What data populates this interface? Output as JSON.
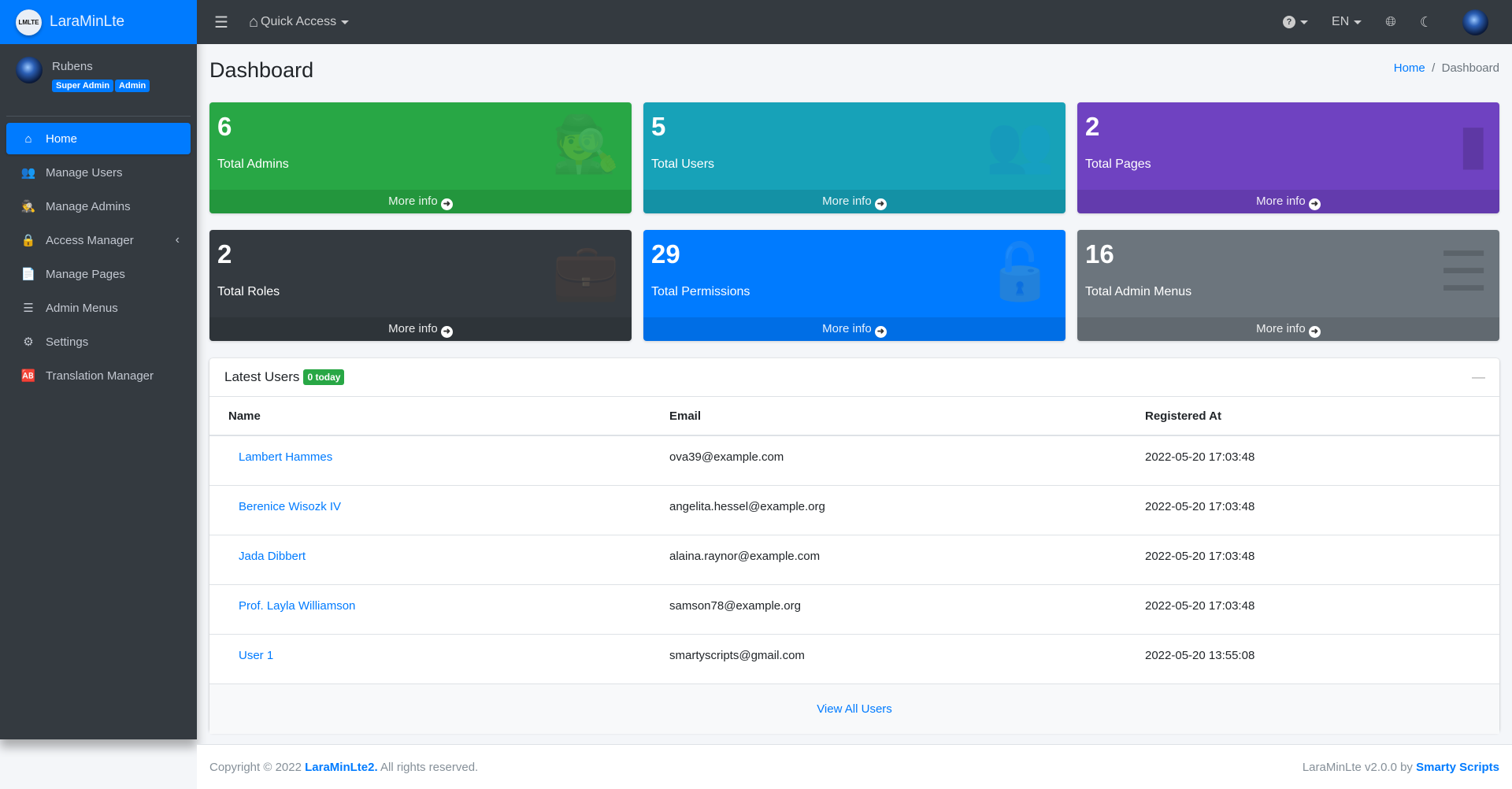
{
  "brand": {
    "logo": "LMLTE",
    "name": "LaraMinLte"
  },
  "user": {
    "name": "Rubens",
    "roles": [
      "Super Admin",
      "Admin"
    ]
  },
  "nav": [
    {
      "label": "Home",
      "icon": "home-icon",
      "glyph": "⌂"
    },
    {
      "label": "Manage Users",
      "icon": "users-icon",
      "glyph": "👥"
    },
    {
      "label": "Manage Admins",
      "icon": "user-secret-icon",
      "glyph": "🕵"
    },
    {
      "label": "Access Manager",
      "icon": "lock-icon",
      "glyph": "🔒"
    },
    {
      "label": "Manage Pages",
      "icon": "file-icon",
      "glyph": "📄"
    },
    {
      "label": "Admin Menus",
      "icon": "bars-icon",
      "glyph": "☰"
    },
    {
      "label": "Settings",
      "icon": "gear-icon",
      "glyph": "⚙"
    },
    {
      "label": "Translation Manager",
      "icon": "language-icon",
      "glyph": "🆎"
    }
  ],
  "topbar": {
    "quick_access": "Quick Access",
    "lang": "EN"
  },
  "page": {
    "title": "Dashboard",
    "breadcrumb": [
      "Home",
      "Dashboard"
    ]
  },
  "boxes": [
    {
      "value": "6",
      "label": "Total Admins",
      "more": "More info",
      "color": "#28a745",
      "icon": "user-secret-icon",
      "glyph": "🕵"
    },
    {
      "value": "5",
      "label": "Total Users",
      "more": "More info",
      "color": "#17a2b8",
      "icon": "users-icon",
      "glyph": "👥"
    },
    {
      "value": "2",
      "label": "Total Pages",
      "more": "More info",
      "color": "#6f42c1",
      "icon": "file-icon",
      "glyph": "▮"
    },
    {
      "value": "2",
      "label": "Total Roles",
      "more": "More info",
      "color": "#343a40",
      "icon": "briefcase-icon",
      "glyph": "💼"
    },
    {
      "value": "29",
      "label": "Total Permissions",
      "more": "More info",
      "color": "#007bff",
      "icon": "unlock-icon",
      "glyph": "🔓"
    },
    {
      "value": "16",
      "label": "Total Admin Menus",
      "more": "More info",
      "color": "#6c757d",
      "icon": "bars-icon",
      "glyph": "☰"
    }
  ],
  "latest": {
    "title": "Latest Users",
    "badge": "0 today",
    "columns": [
      "Name",
      "Email",
      "Registered At"
    ],
    "rows": [
      [
        "Lambert Hammes",
        "ova39@example.com",
        "2022-05-20 17:03:48"
      ],
      [
        "Berenice Wisozk IV",
        "angelita.hessel@example.org",
        "2022-05-20 17:03:48"
      ],
      [
        "Jada Dibbert",
        "alaina.raynor@example.com",
        "2022-05-20 17:03:48"
      ],
      [
        "Prof. Layla Williamson",
        "samson78@example.org",
        "2022-05-20 17:03:48"
      ],
      [
        "User 1",
        "smartyscripts@gmail.com",
        "2022-05-20 13:55:08"
      ]
    ],
    "view_all": "View All Users"
  },
  "footer": {
    "copyright": "Copyright © 2022 ",
    "brand": "LaraMinLte2.",
    "rights": " All rights reserved.",
    "version": "LaraMinLte v2.0.0 by ",
    "author": "Smarty Scripts"
  }
}
